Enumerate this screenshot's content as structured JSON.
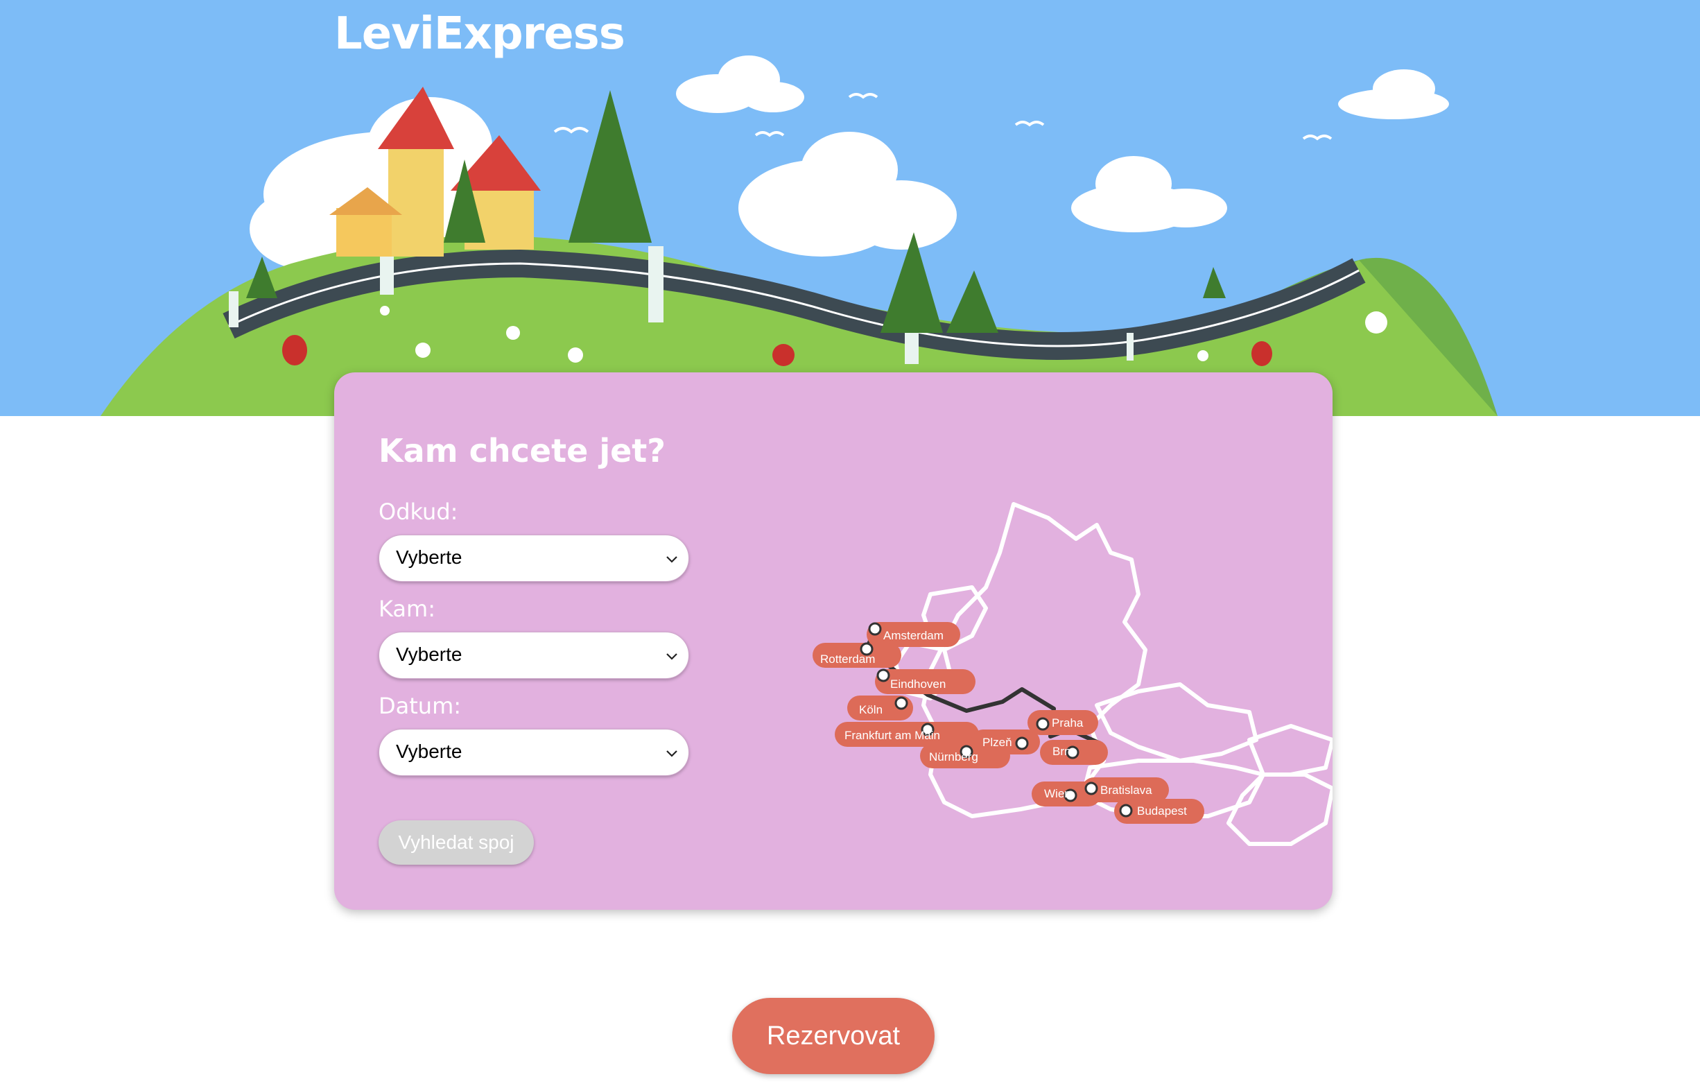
{
  "header": {
    "brand": "LeviExpress"
  },
  "search_form": {
    "title": "Kam chcete jet?",
    "from_label": "Odkud:",
    "from_value": "Vyberte",
    "to_label": "Kam:",
    "to_value": "Vyberte",
    "date_label": "Datum:",
    "date_value": "Vyberte",
    "search_button": "Vyhledat spoj"
  },
  "map": {
    "cities": [
      "Amsterdam",
      "Rotterdam",
      "Eindhoven",
      "Köln",
      "Frankfurt am Main",
      "Nürnberg",
      "Plzeň",
      "Praha",
      "Brno",
      "Wien",
      "Bratislava",
      "Budapest"
    ]
  },
  "reserve_button": "Rezervovat",
  "colors": {
    "sky": "#7dbcf7",
    "card": "#e2b1df",
    "accent": "#e0705e",
    "disabled": "#d3d3d3"
  }
}
